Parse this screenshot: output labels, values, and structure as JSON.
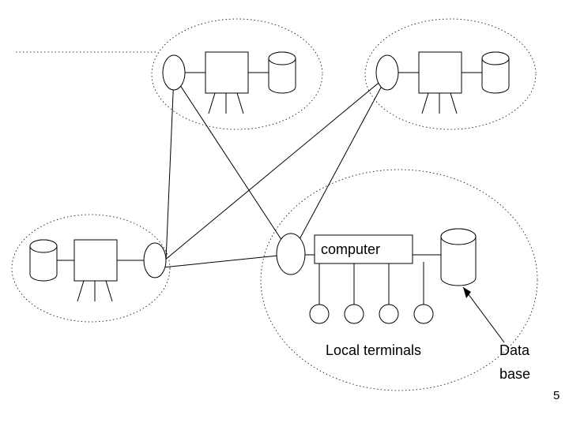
{
  "labels": {
    "computer": "computer",
    "local_terminals": "Local terminals",
    "database_line1": "Data",
    "database_line2": "base"
  },
  "page_number": "5"
}
